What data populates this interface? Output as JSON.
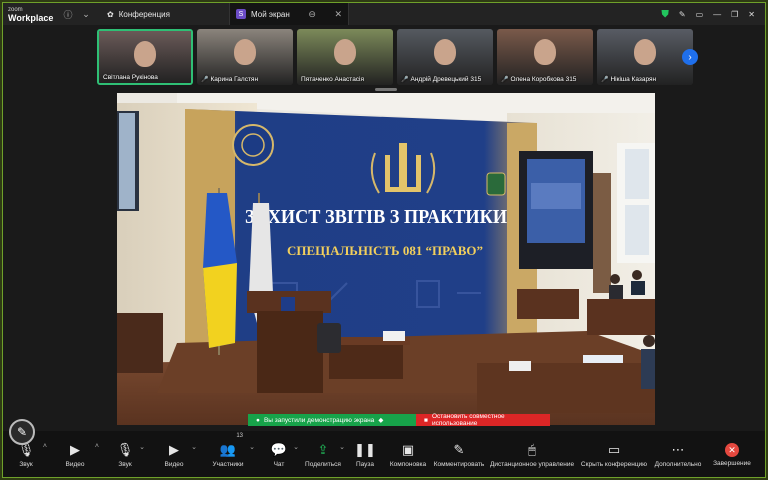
{
  "titlebar": {
    "brand_top": "zoom",
    "brand_bottom": "Workplace",
    "tab_conference": "Конференция",
    "tab_screen": "Мой экран",
    "tab_screen_badge": "S"
  },
  "participants": [
    {
      "name": "Світлана Рукінова",
      "muted": false,
      "active": true,
      "bg": "#6a5a58"
    },
    {
      "name": "Карина Галстян",
      "muted": true,
      "active": false,
      "bg": "#8b847c"
    },
    {
      "name": "Пятаченко Анастасія",
      "muted": false,
      "active": false,
      "bg": "#7c8a5a"
    },
    {
      "name": "Андрій Древецький 315",
      "muted": true,
      "active": false,
      "bg": "#555a60"
    },
    {
      "name": "Олена Коробкова 315",
      "muted": true,
      "active": false,
      "bg": "#7a5a4a"
    },
    {
      "name": "Нікіша Казарян",
      "muted": true,
      "active": false,
      "bg": "#585c64"
    }
  ],
  "slide": {
    "headline": "ЗАХИСТ ЗВІТІВ З ПРАКТИКИ",
    "subline": "СПЕЦІАЛЬНІСТЬ 081 “ПРАВО”"
  },
  "share_status": {
    "started": "Вы запустили демонстрацию экрана",
    "stop": "Остановить совместное использование"
  },
  "toolbar": {
    "audio": "Звук",
    "video": "Видео",
    "audio2": "Звук",
    "video2": "Видео",
    "participants": "Участники",
    "participants_count": "13",
    "chat": "Чат",
    "share": "Поделиться",
    "pause": "Пауза",
    "layout": "Компоновка",
    "annotate": "Комментировать",
    "remote": "Дистанционное управление",
    "hide": "Скрыть конференцию",
    "more": "Дополнительно",
    "end": "Завершение"
  },
  "colors": {
    "accent_green": "#17a34a",
    "stop_red": "#dc2626",
    "active_border": "#2fbf75",
    "frame_border": "#6fa12a"
  }
}
